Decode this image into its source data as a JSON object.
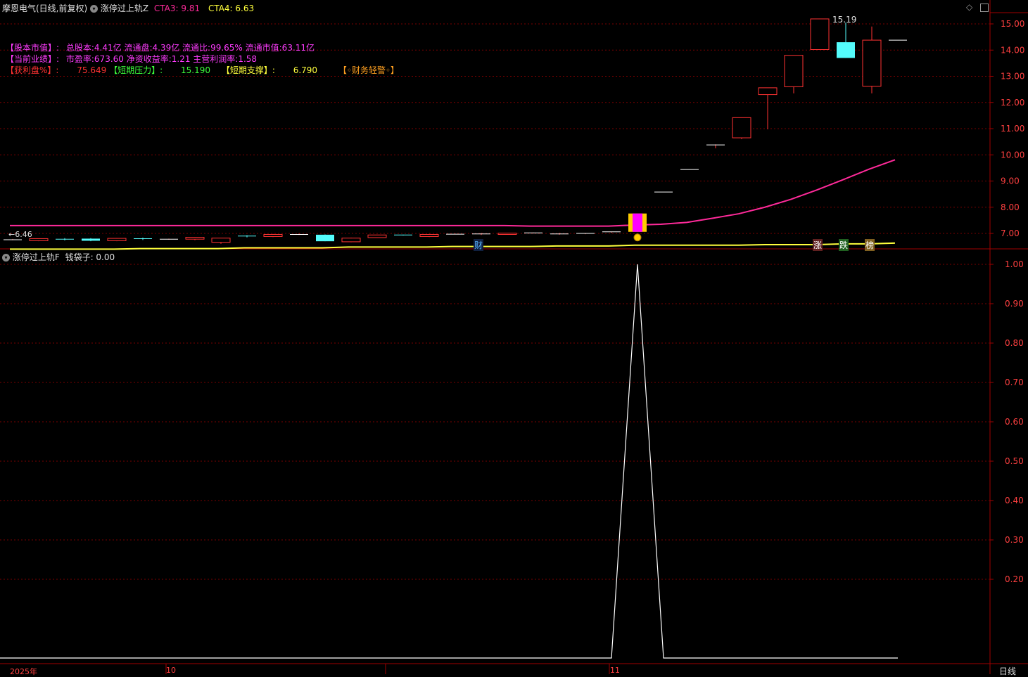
{
  "header": {
    "title": "摩恩电气(日线,前复权)",
    "indicator_name": "涨停过上轨Z",
    "cta3_label": "CTA3: 9.81",
    "cta4_label": "CTA4: 6.63"
  },
  "info_lines": {
    "line1": {
      "label": "【股本市值】:",
      "content": "总股本:4.41亿 流通盘:4.39亿 流通比:99.65% 流通市值:63.11亿"
    },
    "line2": {
      "label": "【当前业绩】:",
      "content": "市盈率:673.60 净资收益率:1.21 主营利润率:1.58"
    },
    "line3": {
      "profit_label": "【获利盘%】:",
      "profit_value": "75.649",
      "pressure_label": "【短期压力】:",
      "pressure_value": "15.190",
      "support_label": "【短期支撑】:",
      "support_value": "6.790",
      "warning": "【◦财务轻警◦】"
    }
  },
  "sub_header": {
    "indicator_name": "涨停过上轨F",
    "value_label": "钱袋子: 0.00"
  },
  "bottom_axis": {
    "labels": [
      "2025年",
      "10",
      "11"
    ],
    "period_label": "日线"
  },
  "markers": {
    "cai": "财",
    "zhang": "涨",
    "die": "跌",
    "bang": "榜"
  },
  "colors": {
    "up": "#ff3232",
    "down": "#54fcfc",
    "ma_magenta": "#ff2a9a",
    "ma_yellow": "#ffff3c",
    "grid": "#7a0000",
    "axis": "#a00000",
    "price_text": "#ff4040"
  },
  "chart_data": [
    {
      "type": "candlestick",
      "title": "",
      "ylim": [
        6.1,
        15.7
      ],
      "yticks": [
        "15.00",
        "14.00",
        "13.00",
        "12.00",
        "11.00",
        "10.00",
        "9.00",
        "8.00",
        "7.00"
      ],
      "max_label": "15.19",
      "min_label": "6.46",
      "candles": [
        {
          "o": 6.76,
          "h": 6.79,
          "l": 6.74,
          "c": 6.76
        },
        {
          "o": 6.72,
          "h": 6.8,
          "l": 6.7,
          "c": 6.8
        },
        {
          "o": 6.78,
          "h": 6.82,
          "l": 6.73,
          "c": 6.76
        },
        {
          "o": 6.8,
          "h": 6.82,
          "l": 6.7,
          "c": 6.72
        },
        {
          "o": 6.72,
          "h": 6.82,
          "l": 6.7,
          "c": 6.81
        },
        {
          "o": 6.8,
          "h": 6.84,
          "l": 6.75,
          "c": 6.78
        },
        {
          "o": 6.78,
          "h": 6.8,
          "l": 6.76,
          "c": 6.78
        },
        {
          "o": 6.78,
          "h": 6.86,
          "l": 6.74,
          "c": 6.85
        },
        {
          "o": 6.66,
          "h": 6.82,
          "l": 6.6,
          "c": 6.82
        },
        {
          "o": 6.9,
          "h": 6.93,
          "l": 6.85,
          "c": 6.88
        },
        {
          "o": 6.88,
          "h": 6.98,
          "l": 6.86,
          "c": 6.96
        },
        {
          "o": 6.96,
          "h": 7.0,
          "l": 6.94,
          "c": 6.96
        },
        {
          "o": 6.95,
          "h": 6.96,
          "l": 6.7,
          "c": 6.7
        },
        {
          "o": 6.68,
          "h": 6.84,
          "l": 6.66,
          "c": 6.82
        },
        {
          "o": 6.84,
          "h": 6.95,
          "l": 6.83,
          "c": 6.94
        },
        {
          "o": 6.94,
          "h": 6.95,
          "l": 6.92,
          "c": 6.93
        },
        {
          "o": 6.88,
          "h": 6.98,
          "l": 6.86,
          "c": 6.96
        },
        {
          "o": 6.97,
          "h": 6.99,
          "l": 6.96,
          "c": 6.97
        },
        {
          "o": 6.98,
          "h": 7.02,
          "l": 6.94,
          "c": 6.98
        },
        {
          "o": 6.96,
          "h": 7.01,
          "l": 6.95,
          "c": 7.01
        },
        {
          "o": 7.01,
          "h": 7.03,
          "l": 7.0,
          "c": 7.02
        },
        {
          "o": 6.98,
          "h": 7.02,
          "l": 6.95,
          "c": 6.98
        },
        {
          "o": 6.98,
          "h": 7.01,
          "l": 6.97,
          "c": 7.0
        },
        {
          "o": 7.03,
          "h": 7.06,
          "l": 7.02,
          "c": 7.06
        },
        {
          "o": 7.06,
          "h": 7.76,
          "l": 7.06,
          "c": 7.76
        },
        {
          "o": 8.58,
          "h": 8.58,
          "l": 8.58,
          "c": 8.58
        },
        {
          "o": 9.44,
          "h": 9.44,
          "l": 9.44,
          "c": 9.44
        },
        {
          "o": 10.38,
          "h": 10.4,
          "l": 10.25,
          "c": 10.38
        },
        {
          "o": 10.65,
          "h": 11.42,
          "l": 10.6,
          "c": 11.42
        },
        {
          "o": 12.3,
          "h": 12.56,
          "l": 10.98,
          "c": 12.56
        },
        {
          "o": 12.6,
          "h": 13.8,
          "l": 12.35,
          "c": 13.8
        },
        {
          "o": 14.02,
          "h": 15.19,
          "l": 14.02,
          "c": 15.19
        },
        {
          "o": 14.3,
          "h": 15.05,
          "l": 13.7,
          "c": 13.7
        },
        {
          "o": 12.62,
          "h": 14.9,
          "l": 12.35,
          "c": 14.38
        },
        {
          "o": 14.38,
          "h": 14.38,
          "l": 14.38,
          "c": 14.38
        }
      ],
      "series": [
        {
          "name": "CTA3",
          "values": [
            7.3,
            7.3,
            7.3,
            7.3,
            7.3,
            7.3,
            7.3,
            7.3,
            7.3,
            7.3,
            7.3,
            7.3,
            7.3,
            7.3,
            7.3,
            7.3,
            7.3,
            7.3,
            7.3,
            7.3,
            7.28,
            7.28,
            7.28,
            7.28,
            7.32,
            7.35,
            7.42,
            7.58,
            7.75,
            8.0,
            8.3,
            8.66,
            9.05,
            9.45,
            9.81
          ]
        },
        {
          "name": "CTA4",
          "values": [
            6.4,
            6.4,
            6.4,
            6.4,
            6.4,
            6.42,
            6.42,
            6.42,
            6.42,
            6.45,
            6.45,
            6.45,
            6.45,
            6.48,
            6.48,
            6.48,
            6.48,
            6.5,
            6.5,
            6.5,
            6.5,
            6.52,
            6.52,
            6.52,
            6.55,
            6.55,
            6.55,
            6.55,
            6.55,
            6.57,
            6.57,
            6.57,
            6.6,
            6.6,
            6.63
          ]
        }
      ]
    },
    {
      "type": "line",
      "title": "",
      "ylim": [
        0,
        1.05
      ],
      "yticks": [
        "1.00",
        "0.90",
        "0.80",
        "0.70",
        "0.60",
        "0.50",
        "0.40",
        "0.30",
        "0.20"
      ],
      "series": [
        {
          "name": "钱袋子",
          "values": [
            0,
            0,
            0,
            0,
            0,
            0,
            0,
            0,
            0,
            0,
            0,
            0,
            0,
            0,
            0,
            0,
            0,
            0,
            0,
            0,
            0,
            0,
            0,
            0,
            1,
            0,
            0,
            0,
            0,
            0,
            0,
            0,
            0,
            0,
            0
          ]
        }
      ]
    }
  ]
}
